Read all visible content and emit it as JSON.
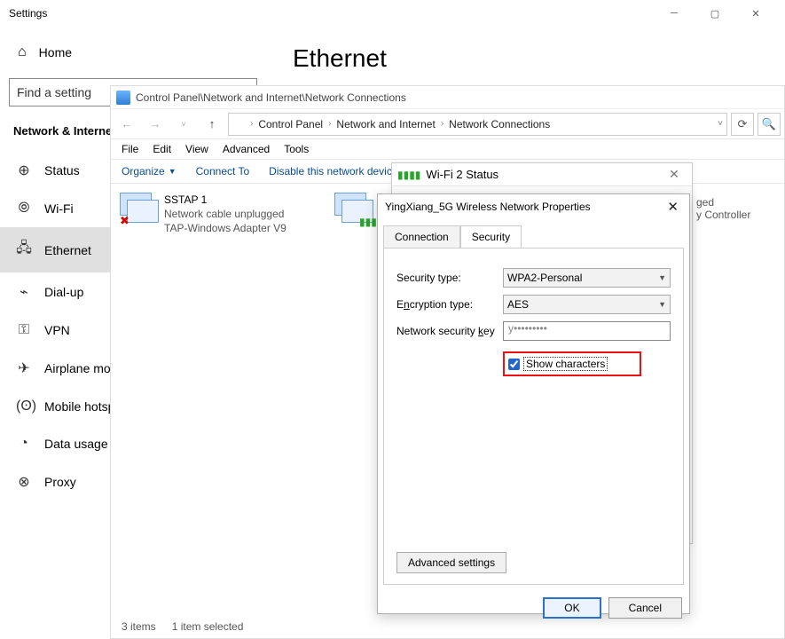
{
  "settings": {
    "title": "Settings",
    "home": "Home",
    "search_placeholder": "Find a setting",
    "section": "Network & Internet",
    "nav": [
      {
        "label": "Status",
        "icon": "⊕"
      },
      {
        "label": "Wi-Fi",
        "icon": "⦾"
      },
      {
        "label": "Ethernet",
        "icon": "🖧"
      },
      {
        "label": "Dial-up",
        "icon": "⌁"
      },
      {
        "label": "VPN",
        "icon": "⚿"
      },
      {
        "label": "Airplane mode",
        "icon": "✈"
      },
      {
        "label": "Mobile hotspot",
        "icon": "(ʘ)"
      },
      {
        "label": "Data usage",
        "icon": "◔"
      },
      {
        "label": "Proxy",
        "icon": "⊗"
      }
    ],
    "page_heading": "Ethernet"
  },
  "explorer": {
    "title": "Control Panel\\Network and Internet\\Network Connections",
    "crumbs": [
      "Control Panel",
      "Network and Internet",
      "Network Connections"
    ],
    "menus": [
      "File",
      "Edit",
      "View",
      "Advanced",
      "Tools"
    ],
    "toolbar": {
      "organize": "Organize",
      "connect": "Connect To",
      "disable": "Disable this network device"
    },
    "adapters": [
      {
        "name": "SSTAP 1",
        "status": "Network cable unplugged",
        "device": "TAP-Windows Adapter V9",
        "badge": "x"
      },
      {
        "name": "",
        "status": "",
        "device": "",
        "badge": "bars"
      }
    ],
    "adapter2_tail": "ged",
    "adapter2_tail2": "y Controller",
    "status_bar": {
      "items": "3 items",
      "selected": "1 item selected"
    }
  },
  "status_dialog": {
    "title": "Wi-Fi 2 Status"
  },
  "props_dialog": {
    "title": "YingXiang_5G Wireless Network Properties",
    "tabs": {
      "connection": "Connection",
      "security": "Security"
    },
    "security_type_label": "Security type:",
    "security_type_value": "WPA2-Personal",
    "encryption_label_pre": "E",
    "encryption_label_ul": "n",
    "encryption_label_post": "cryption type:",
    "encryption_value": "AES",
    "key_label_pre": "Network security ",
    "key_label_ul": "k",
    "key_label_post": "ey",
    "key_value": "y•••••••••",
    "show_chars": "Show characters",
    "advanced": "Advanced settings",
    "ok": "OK",
    "cancel": "Cancel"
  }
}
